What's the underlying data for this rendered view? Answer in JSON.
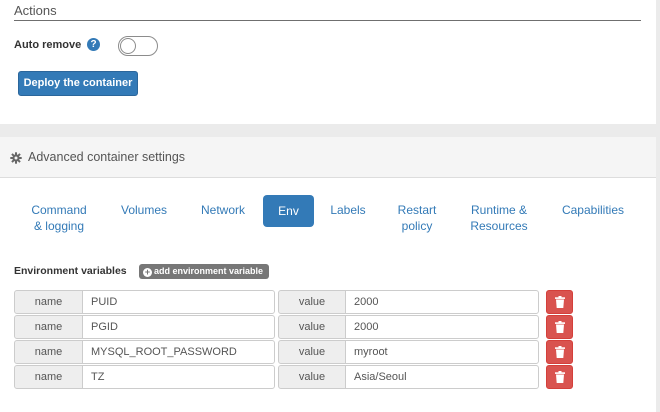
{
  "actions": {
    "title": "Actions",
    "auto_remove_label": "Auto remove",
    "help_icon": "question-circle-icon",
    "help_glyph": "?",
    "auto_remove_enabled": false,
    "deploy_label": "Deploy the container"
  },
  "advanced": {
    "title": "Advanced container settings",
    "icon": "cog-icon",
    "tabs": [
      {
        "line1": "Command",
        "line2": "& logging",
        "active": false
      },
      {
        "line1": "Volumes",
        "line2": "",
        "active": false
      },
      {
        "line1": "Network",
        "line2": "",
        "active": false
      },
      {
        "line1": "Env",
        "line2": "",
        "active": true
      },
      {
        "line1": "Labels",
        "line2": "",
        "active": false
      },
      {
        "line1": "Restart",
        "line2": "policy",
        "active": false
      },
      {
        "line1": "Runtime &",
        "line2": "Resources",
        "active": false
      },
      {
        "line1": "Capabilities",
        "line2": "",
        "active": false
      }
    ]
  },
  "env": {
    "section_label": "Environment variables",
    "add_label": "add environment variable",
    "add_glyph": "+",
    "name_addon": "name",
    "value_addon": "value",
    "rows": [
      {
        "name": "PUID",
        "value": "2000"
      },
      {
        "name": "PGID",
        "value": "2000"
      },
      {
        "name": "MYSQL_ROOT_PASSWORD",
        "value": "myroot"
      },
      {
        "name": "TZ",
        "value": "Asia/Seoul"
      }
    ]
  },
  "colors": {
    "primary": "#337ab7",
    "danger": "#d9534f",
    "label_gray": "#777777"
  }
}
